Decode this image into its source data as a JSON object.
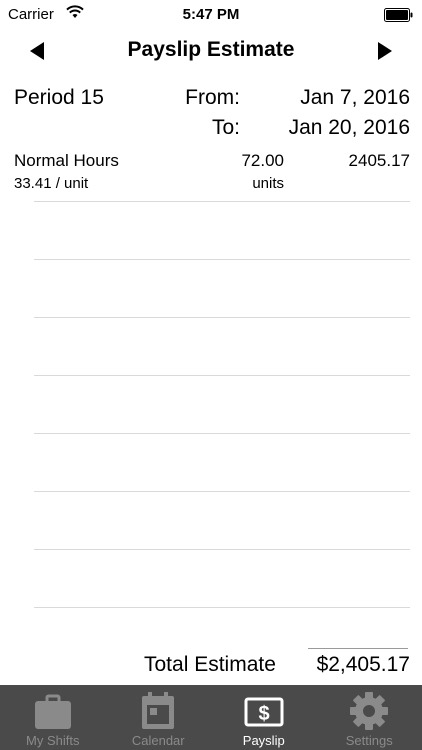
{
  "status_bar": {
    "carrier": "Carrier",
    "time": "5:47 PM"
  },
  "nav": {
    "title": "Payslip Estimate",
    "prev_icon": "left-triangle-icon",
    "next_icon": "right-triangle-icon"
  },
  "period": {
    "label": "Period 15",
    "from_label": "From:",
    "from_date": "Jan 7, 2016",
    "to_label": "To:",
    "to_date": "Jan 20, 2016"
  },
  "items": [
    {
      "name": "Normal Hours",
      "quantity": "72.00",
      "amount": "2405.17",
      "rate": "33.41 / unit",
      "unit": "units"
    }
  ],
  "total": {
    "label": "Total Estimate",
    "value": "$2,405.17"
  },
  "tabs": [
    {
      "label": "My Shifts",
      "icon": "briefcase-icon",
      "active": false
    },
    {
      "label": "Calendar",
      "icon": "calendar-icon",
      "active": false
    },
    {
      "label": "Payslip",
      "icon": "dollar-document-icon",
      "active": true
    },
    {
      "label": "Settings",
      "icon": "gear-icon",
      "active": false
    }
  ],
  "colors": {
    "tab_bar_background": "#4a4a4a",
    "tab_inactive": "#8a8a8a",
    "tab_active": "#ffffff"
  }
}
